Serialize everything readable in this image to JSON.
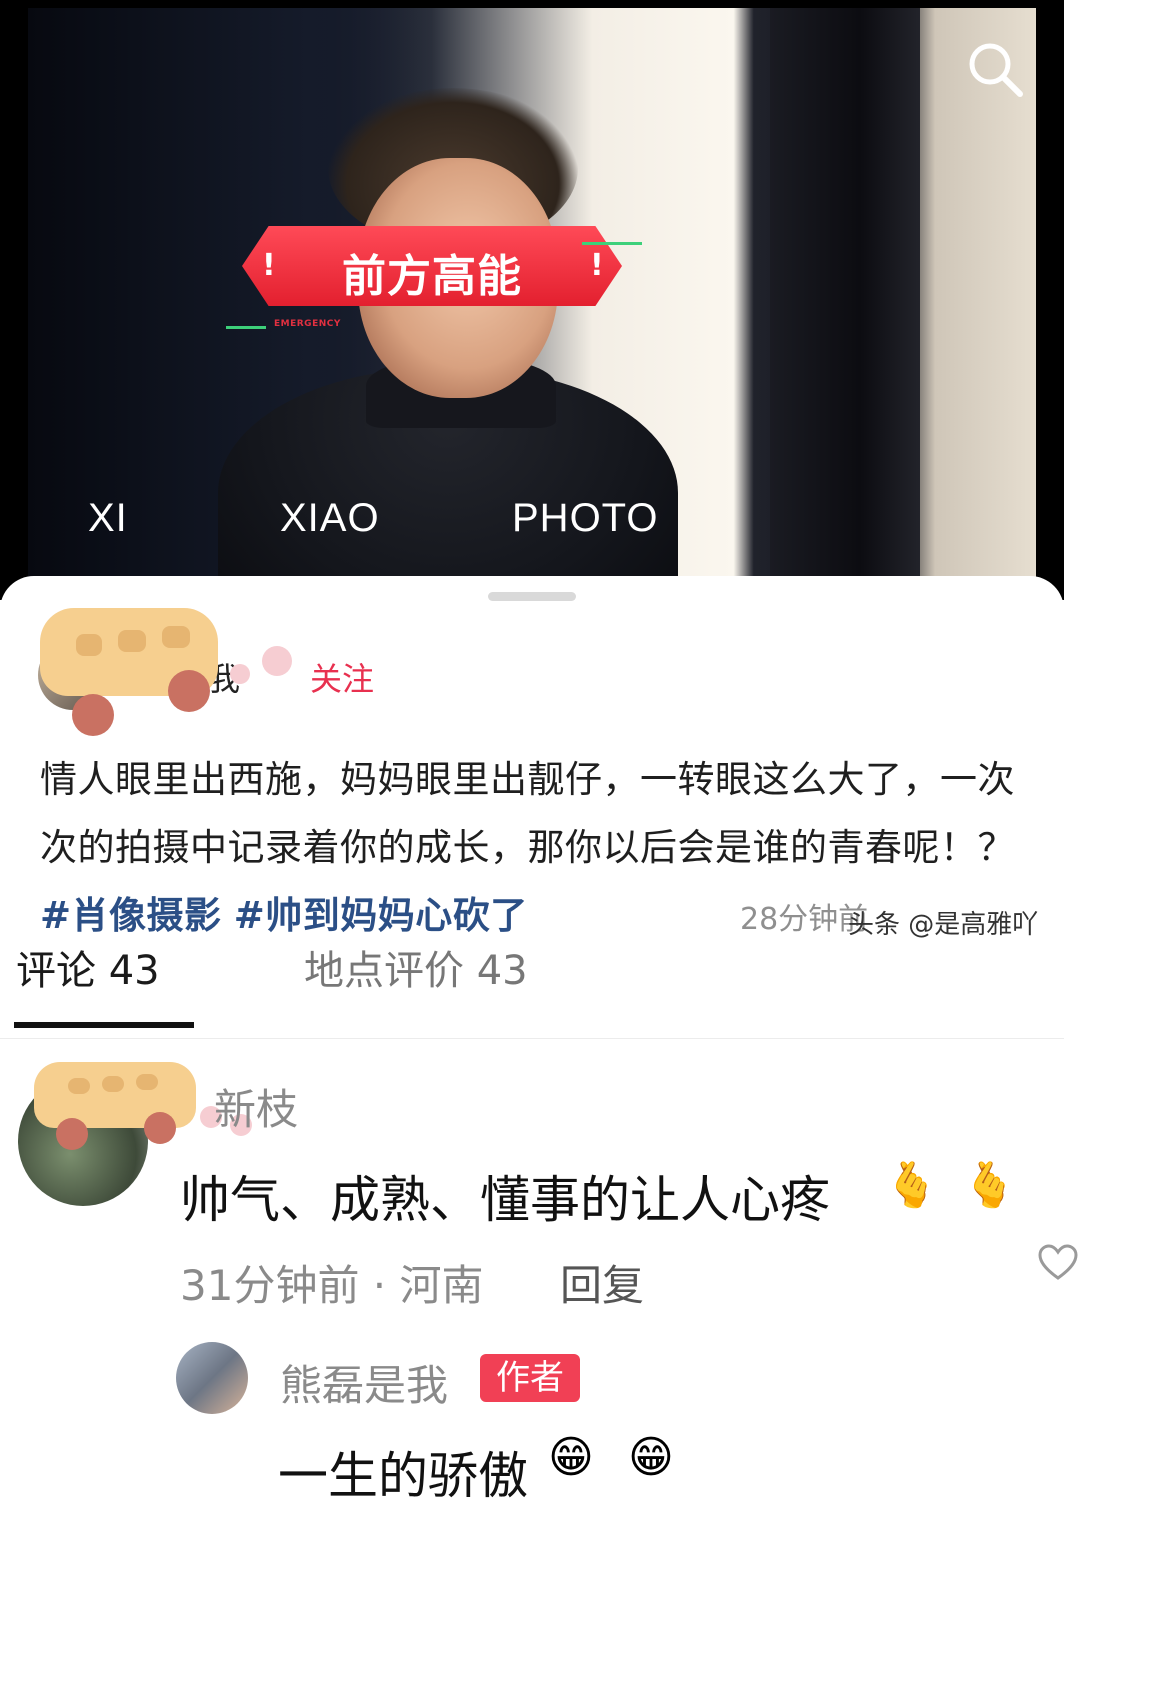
{
  "video": {
    "banner_title": "前方高能",
    "banner_mark": "!",
    "banner_subtitle": "EMERGENCY",
    "labels": [
      "XI",
      "XIAO",
      "PHOTO"
    ],
    "search_icon": "search-icon"
  },
  "post": {
    "author_name": "我",
    "follow_label": "关注",
    "description_text": "情人眼里出西施，妈妈眼里出靓仔，一转眼这么大了，一次次的拍摄中记录着你的成长，那你以后会是谁的青春呢！？",
    "tags": [
      "#肖像摄影",
      "#帅到妈妈心砍了"
    ],
    "time": "28分钟前",
    "watermark": "头条 @是高雅吖"
  },
  "tabs": {
    "comments": "评论 43",
    "place_reviews": "地点评价 43"
  },
  "comment": {
    "username": "新枝",
    "text": "帅气、成熟、懂事的让人心疼",
    "emojis": [
      "🫰",
      "🫰"
    ],
    "meta": "31分钟前 · 河南",
    "reply_label": "回复"
  },
  "reply": {
    "username": "熊磊是我",
    "badge": "作者",
    "text": "一生的骄傲",
    "emojis": [
      "😁",
      "😁"
    ]
  },
  "colors": {
    "follow": "#e8304f",
    "tag": "#2b4f86",
    "badge": "#f14055",
    "banner": "#e3202f"
  }
}
